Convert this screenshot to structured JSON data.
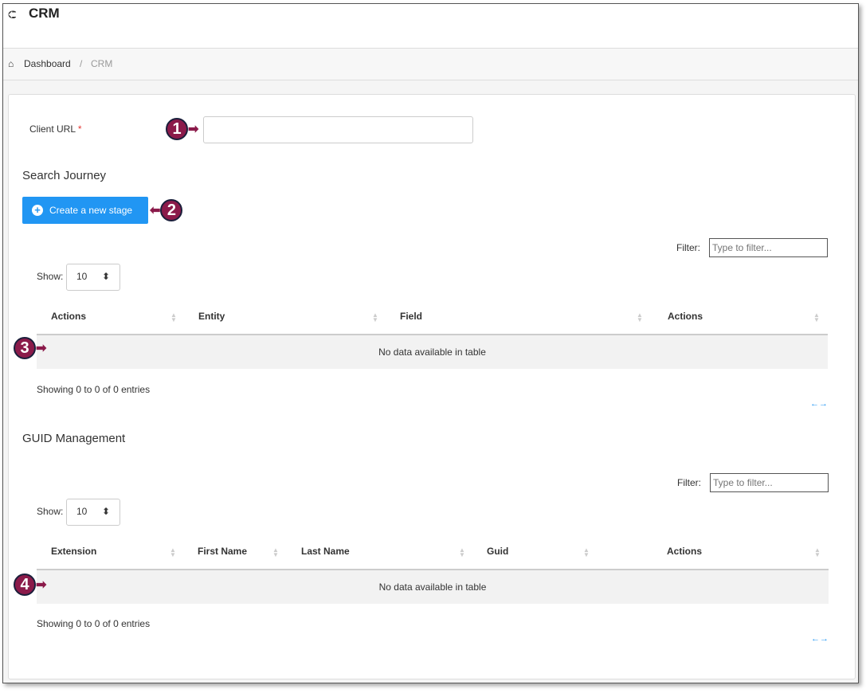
{
  "header": {
    "title": "CRM",
    "back_icon": "arrow-circle-left-icon"
  },
  "breadcrumb": {
    "home": "Dashboard",
    "sep": "/",
    "current": "CRM"
  },
  "form": {
    "client_url_label": "Client URL",
    "required_mark": "*",
    "client_url_value": ""
  },
  "search_journey": {
    "title": "Search Journey",
    "create_button": "Create a new stage",
    "filter_label": "Filter:",
    "filter_placeholder": "Type to filter...",
    "show_label": "Show:",
    "show_value": "10",
    "columns": [
      "Actions",
      "Entity",
      "Field",
      "Actions"
    ],
    "empty": "No data available in table",
    "info": "Showing 0 to 0 of 0 entries",
    "pager": "←→"
  },
  "guid": {
    "title": "GUID Management",
    "filter_label": "Filter:",
    "filter_placeholder": "Type to filter...",
    "show_label": "Show:",
    "show_value": "10",
    "columns": [
      "Extension",
      "First Name",
      "Last Name",
      "Guid",
      "Actions"
    ],
    "empty": "No data available in table",
    "info": "Showing 0 to 0 of 0 entries",
    "pager": "←→"
  },
  "callouts": [
    "1",
    "2",
    "3",
    "4"
  ],
  "colors": {
    "primary": "#2196f3",
    "callout": "#8b1a4a",
    "required": "#e53935"
  }
}
